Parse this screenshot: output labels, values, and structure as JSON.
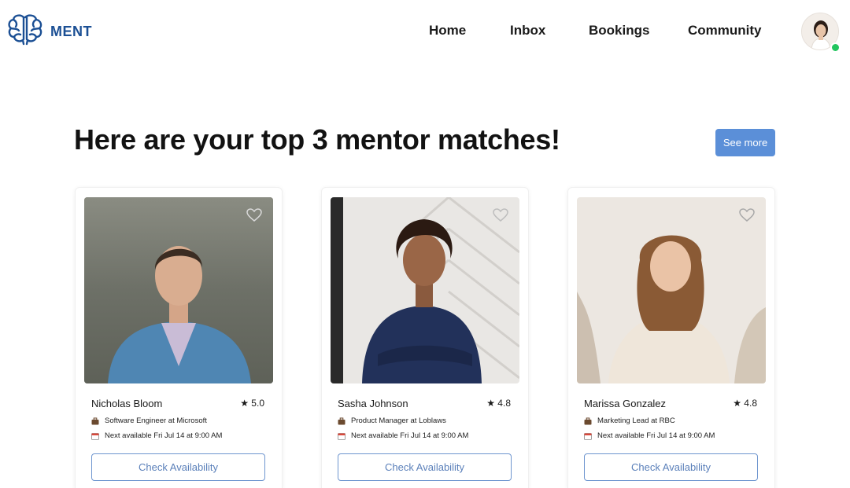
{
  "brand": {
    "name": "MENT",
    "logo_icon": "brain-icon",
    "color": "#1b4f94"
  },
  "nav": {
    "items": [
      {
        "label": "Home"
      },
      {
        "label": "Inbox"
      },
      {
        "label": "Bookings"
      },
      {
        "label": "Community"
      }
    ],
    "status": "online"
  },
  "main": {
    "title": "Here are your top 3 mentor matches!",
    "see_more_label": "See more",
    "accent_color": "#5b8fd8"
  },
  "mentors": [
    {
      "name": "Nicholas Bloom",
      "rating": "★ 5.0",
      "role": "Software Engineer at Microsoft",
      "next": "Next available Fri Jul 14 at 9:00 AM",
      "cta": "Check Availability"
    },
    {
      "name": "Sasha Johnson",
      "rating": "★ 4.8",
      "role": "Product Manager at Loblaws",
      "next": "Next available Fri Jul 14 at 9:00 AM",
      "cta": "Check Availability"
    },
    {
      "name": "Marissa Gonzalez",
      "rating": "★ 4.8",
      "role": "Marketing Lead at RBC",
      "next": "Next available Fri Jul 14 at 9:00 AM",
      "cta": "Check Availability"
    }
  ]
}
